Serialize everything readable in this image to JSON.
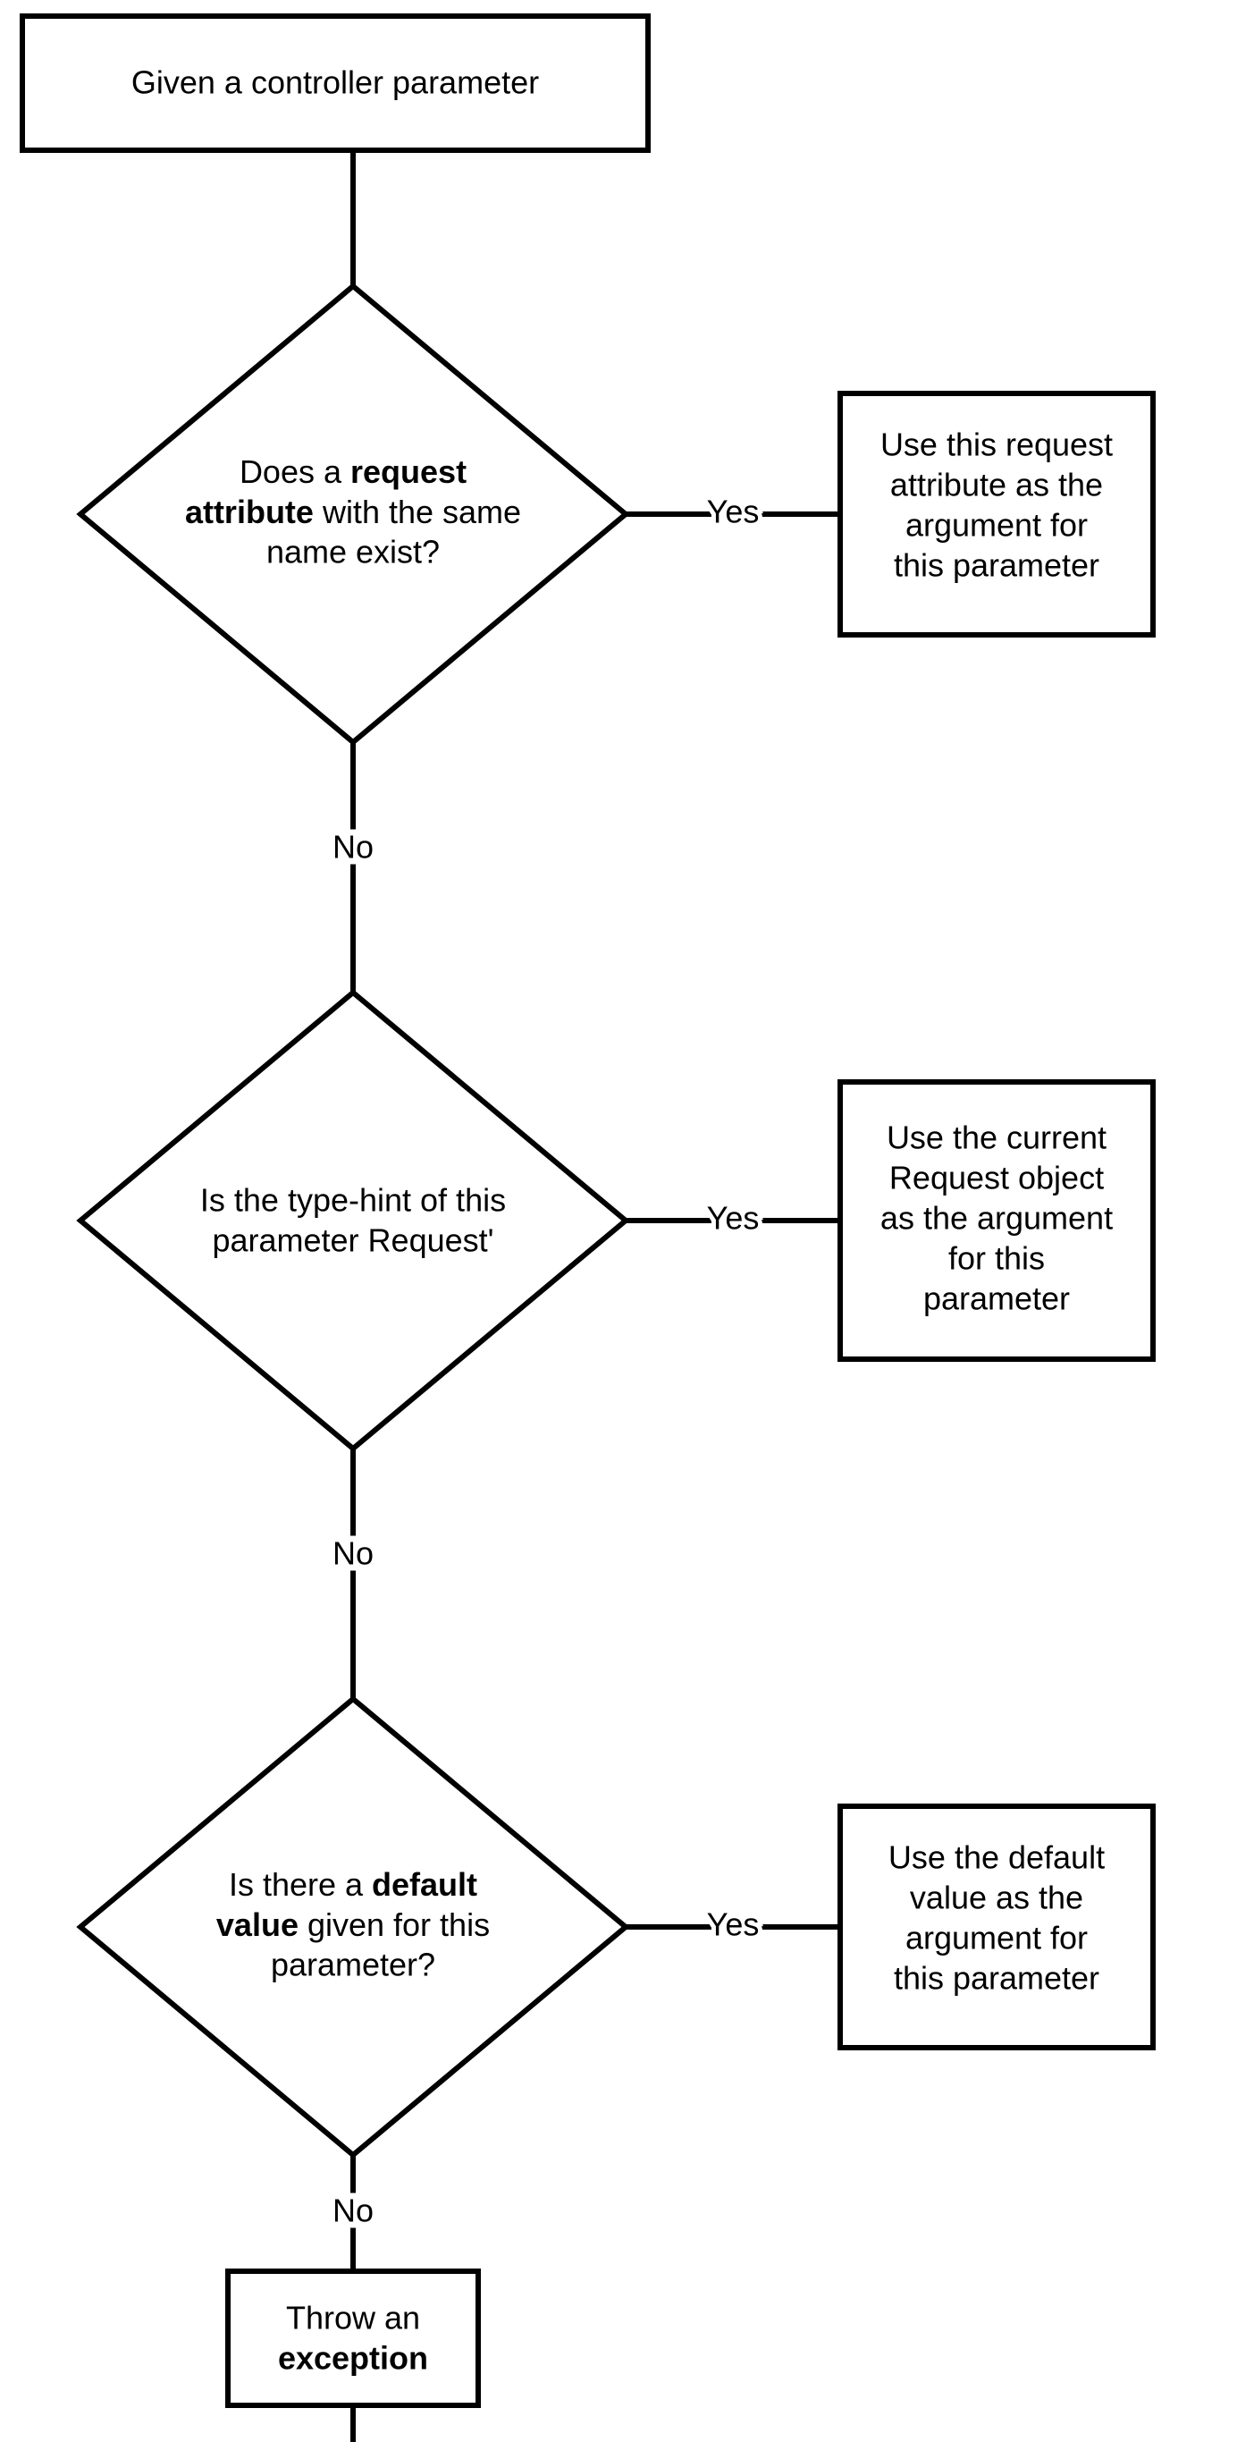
{
  "chart_data": {
    "type": "flowchart",
    "nodes": [
      {
        "id": "start",
        "kind": "process",
        "text": "Given a controller parameter"
      },
      {
        "id": "d1",
        "kind": "decision",
        "text": "Does a request attribute with the same name exist?",
        "bold_phrases": [
          "request attribute"
        ]
      },
      {
        "id": "r1",
        "kind": "process",
        "text": "Use this request attribute as the argument for this parameter"
      },
      {
        "id": "d2",
        "kind": "decision",
        "text": "Is the type-hint of this parameter Request'"
      },
      {
        "id": "r2",
        "kind": "process",
        "text": "Use the current Request object as the argument for this parameter"
      },
      {
        "id": "d3",
        "kind": "decision",
        "text": "Is there a default value given for this parameter?",
        "bold_phrases": [
          "default value"
        ]
      },
      {
        "id": "r3",
        "kind": "process",
        "text": "Use the default value as the argument for this parameter"
      },
      {
        "id": "end",
        "kind": "process",
        "text": "Throw an exception",
        "bold_phrases": [
          "exception"
        ]
      }
    ],
    "edges": [
      {
        "from": "start",
        "to": "d1",
        "label": ""
      },
      {
        "from": "d1",
        "to": "r1",
        "label": "Yes"
      },
      {
        "from": "d1",
        "to": "d2",
        "label": "No"
      },
      {
        "from": "d2",
        "to": "r2",
        "label": "Yes"
      },
      {
        "from": "d2",
        "to": "d3",
        "label": "No"
      },
      {
        "from": "d3",
        "to": "r3",
        "label": "Yes"
      },
      {
        "from": "d3",
        "to": "end",
        "label": "No"
      },
      {
        "from": "end",
        "to": null,
        "label": ""
      }
    ]
  },
  "labels": {
    "yes": "Yes",
    "no": "No"
  },
  "nodes": {
    "start": {
      "l1": "Given a controller parameter"
    },
    "d1": {
      "l1": "Does a ",
      "b1": "request",
      "l2": "attribute",
      "l2b": " with the same",
      "l3": "name exist?"
    },
    "r1": {
      "l1": "Use this request",
      "l2": "attribute as the",
      "l3": "argument for",
      "l4": "this parameter"
    },
    "d2": {
      "l1": "Is the type-hint of this",
      "l2": "parameter Request'"
    },
    "r2": {
      "l1": "Use the current",
      "l2": "Request object",
      "l3": "as the argument",
      "l4": "for this",
      "l5": "parameter"
    },
    "d3": {
      "l1": "Is there a ",
      "b1": "default",
      "l2": "value",
      "l2b": " given for this",
      "l3": "parameter?"
    },
    "r3": {
      "l1": "Use the default",
      "l2": "value as the",
      "l3": "argument for",
      "l4": "this parameter"
    },
    "end": {
      "l1": "Throw an",
      "l2": "exception"
    }
  }
}
